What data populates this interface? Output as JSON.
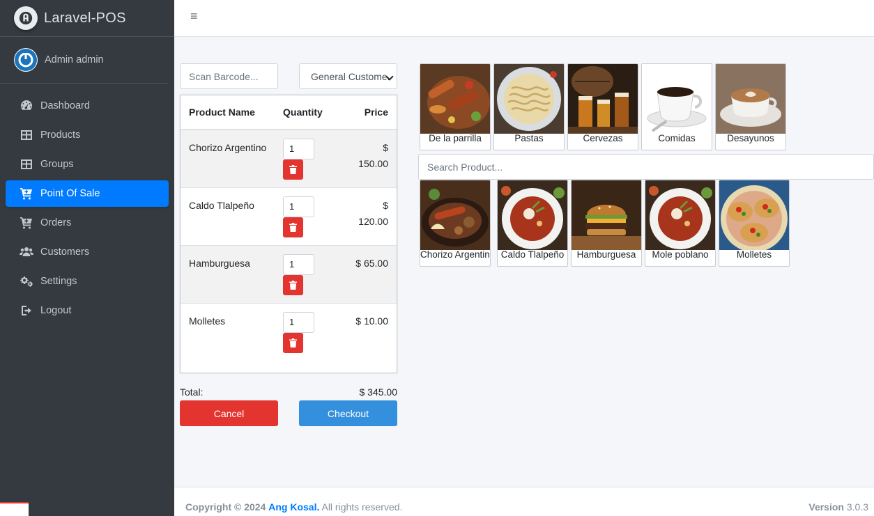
{
  "brand": {
    "name": "Laravel-POS",
    "logo_icon": "laravel-logo-icon"
  },
  "user": {
    "name": "Admin admin",
    "avatar_icon": "power-avatar-icon"
  },
  "sidebar": {
    "items": [
      {
        "label": "Dashboard",
        "icon": "tachometer-icon",
        "active": false
      },
      {
        "label": "Products",
        "icon": "table-icon",
        "active": false
      },
      {
        "label": "Groups",
        "icon": "table-icon",
        "active": false
      },
      {
        "label": "Point Of Sale",
        "icon": "cart-plus-icon",
        "active": true
      },
      {
        "label": "Orders",
        "icon": "cart-plus-icon",
        "active": false
      },
      {
        "label": "Customers",
        "icon": "users-icon",
        "active": false
      },
      {
        "label": "Settings",
        "icon": "cogs-icon",
        "active": false
      },
      {
        "label": "Logout",
        "icon": "sign-out-icon",
        "active": false
      }
    ]
  },
  "header": {
    "menu_icon": "hamburger-icon",
    "menu_glyph": "≡"
  },
  "pos": {
    "barcode_placeholder": "Scan Barcode...",
    "customer_select": "General Customer",
    "table_headers": {
      "name": "Product Name",
      "quantity": "Quantity",
      "price": "Price"
    },
    "cart": [
      {
        "name": "Chorizo Argentino",
        "qty": "1",
        "price": "$ 150.00"
      },
      {
        "name": "Caldo Tlalpeño",
        "qty": "1",
        "price": "$ 120.00"
      },
      {
        "name": "Hamburguesa",
        "qty": "1",
        "price": "$ 65.00"
      },
      {
        "name": "Molletes",
        "qty": "1",
        "price": "$ 10.00"
      }
    ],
    "total_label": "Total:",
    "total_value": "$ 345.00",
    "cancel_label": "Cancel",
    "checkout_label": "Checkout"
  },
  "categories": [
    {
      "label": "De la parrilla"
    },
    {
      "label": "Pastas"
    },
    {
      "label": "Cervezas"
    },
    {
      "label": "Comidas"
    },
    {
      "label": "Desayunos"
    }
  ],
  "product_search_placeholder": "Search Product...",
  "products": [
    {
      "label": "Chorizo Argentino"
    },
    {
      "label": "Caldo Tlalpeño"
    },
    {
      "label": "Hamburguesa"
    },
    {
      "label": "Mole poblano"
    },
    {
      "label": "Molletes"
    }
  ],
  "footer": {
    "copyright_prefix": "Copyright © 2024",
    "author": "Ang Kosal.",
    "rights": "All rights reserved.",
    "version_label": "Version",
    "version_value": "3.0.3"
  },
  "colors": {
    "sidebar": "#343a40",
    "active": "#007bff",
    "danger": "#e3342f",
    "primary": "#3490dc"
  }
}
